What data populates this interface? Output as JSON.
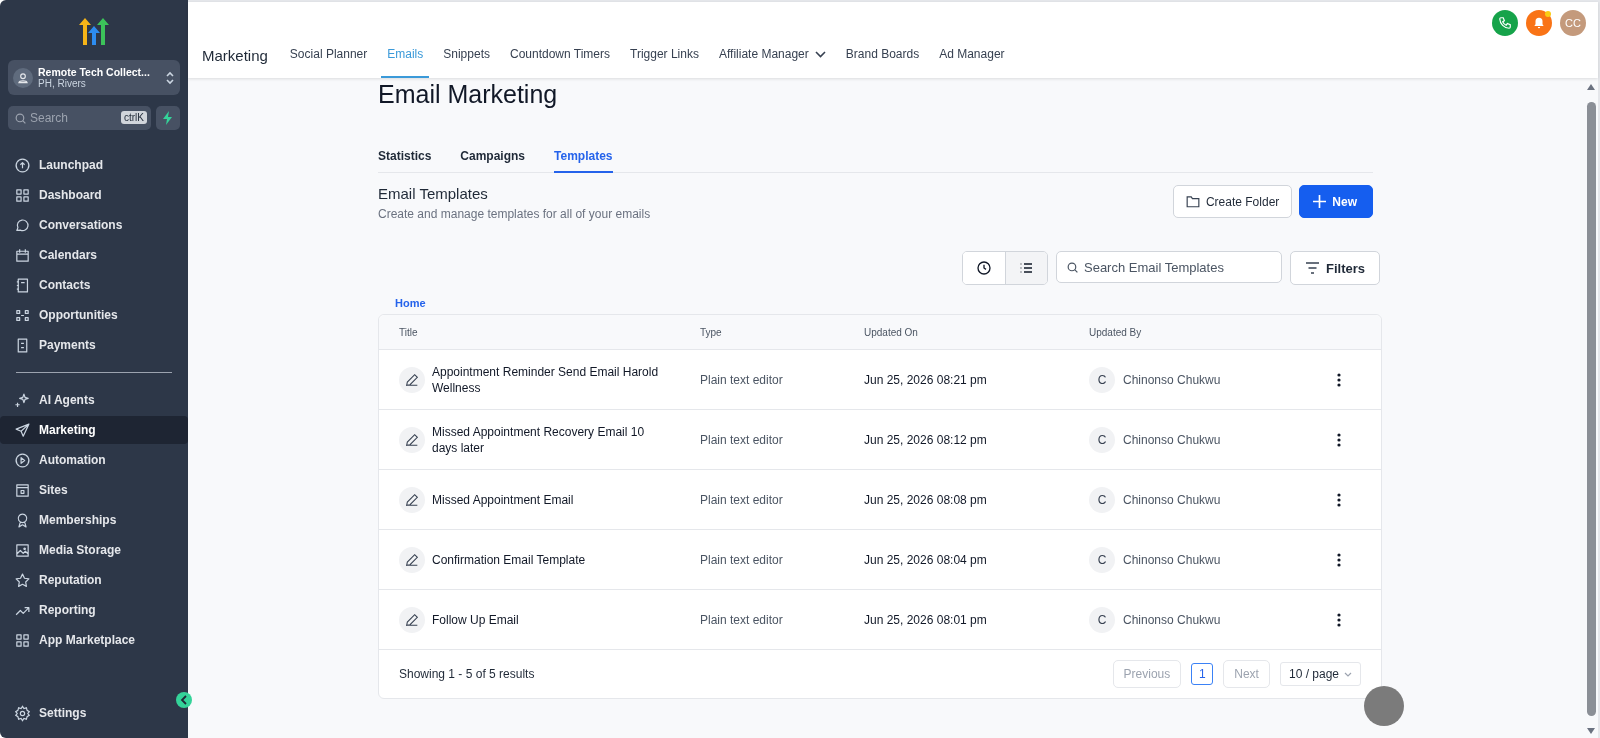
{
  "sidebar": {
    "account": {
      "name": "Remote Tech Collect...",
      "location": "PH, Rivers"
    },
    "search": {
      "placeholder": "Search",
      "shortcut": "ctrlK"
    },
    "nav_groups": [
      {
        "items": [
          {
            "label": "Launchpad",
            "selected": false
          },
          {
            "label": "Dashboard",
            "selected": false
          },
          {
            "label": "Conversations",
            "selected": false
          },
          {
            "label": "Calendars",
            "selected": false
          },
          {
            "label": "Contacts",
            "selected": false
          },
          {
            "label": "Opportunities",
            "selected": false
          },
          {
            "label": "Payments",
            "selected": false
          }
        ]
      },
      {
        "items": [
          {
            "label": "AI Agents",
            "selected": false
          },
          {
            "label": "Marketing",
            "selected": true
          },
          {
            "label": "Automation",
            "selected": false
          },
          {
            "label": "Sites",
            "selected": false
          },
          {
            "label": "Memberships",
            "selected": false
          },
          {
            "label": "Media Storage",
            "selected": false
          },
          {
            "label": "Reputation",
            "selected": false
          },
          {
            "label": "Reporting",
            "selected": false
          },
          {
            "label": "App Marketplace",
            "selected": false
          }
        ]
      }
    ],
    "settings": "Settings"
  },
  "topbar": {
    "section": "Marketing",
    "tabs": [
      {
        "label": "Social Planner",
        "selected": false
      },
      {
        "label": "Emails",
        "selected": true
      },
      {
        "label": "Snippets",
        "selected": false
      },
      {
        "label": "Countdown Timers",
        "selected": false
      },
      {
        "label": "Trigger Links",
        "selected": false
      },
      {
        "label": "Affiliate Manager",
        "selected": false,
        "dropdown": true
      },
      {
        "label": "Brand Boards",
        "selected": false
      },
      {
        "label": "Ad Manager",
        "selected": false
      }
    ],
    "avatar": "CC",
    "notification_dot": true
  },
  "page": {
    "title": "Email Marketing",
    "tabs": [
      {
        "label": "Statistics",
        "selected": false
      },
      {
        "label": "Campaigns",
        "selected": false
      },
      {
        "label": "Templates",
        "selected": true
      }
    ],
    "heading": "Email Templates",
    "subtitle": "Create and manage templates for all of your emails",
    "buttons": {
      "create_folder": "Create Folder",
      "new": "New"
    },
    "view_toggle": [
      {
        "kind": "recent",
        "selected": false
      },
      {
        "kind": "list",
        "selected": true
      }
    ],
    "search": {
      "placeholder": "Search Email Templates"
    },
    "filters": "Filters",
    "breadcrumb": "Home"
  },
  "table": {
    "columns": [
      "Title",
      "Type",
      "Updated On",
      "Updated By"
    ],
    "rows": [
      {
        "title": "Appointment Reminder Send Email Harold Wellness",
        "type": "Plain text editor",
        "updated_on": "Jun 25, 2026 08:21 pm",
        "initial": "C",
        "updated_by": "Chinonso Chukwu"
      },
      {
        "title": "Missed Appointment Recovery Email 10 days later",
        "type": "Plain text editor",
        "updated_on": "Jun 25, 2026 08:12 pm",
        "initial": "C",
        "updated_by": "Chinonso Chukwu"
      },
      {
        "title": "Missed Appointment Email",
        "type": "Plain text editor",
        "updated_on": "Jun 25, 2026 08:08 pm",
        "initial": "C",
        "updated_by": "Chinonso Chukwu"
      },
      {
        "title": "Confirmation Email Template",
        "type": "Plain text editor",
        "updated_on": "Jun 25, 2026 08:04 pm",
        "initial": "C",
        "updated_by": "Chinonso Chukwu"
      },
      {
        "title": "Follow Up Email",
        "type": "Plain text editor",
        "updated_on": "Jun 25, 2026 08:01 pm",
        "initial": "C",
        "updated_by": "Chinonso Chukwu"
      }
    ],
    "summary": "Showing 1 - 5 of 5 results",
    "pagination": {
      "previous": {
        "label": "Previous",
        "disabled": true
      },
      "pages": [
        {
          "label": "1",
          "selected": true
        }
      ],
      "next": {
        "label": "Next",
        "disabled": true
      },
      "page_size": "10 / page"
    }
  }
}
